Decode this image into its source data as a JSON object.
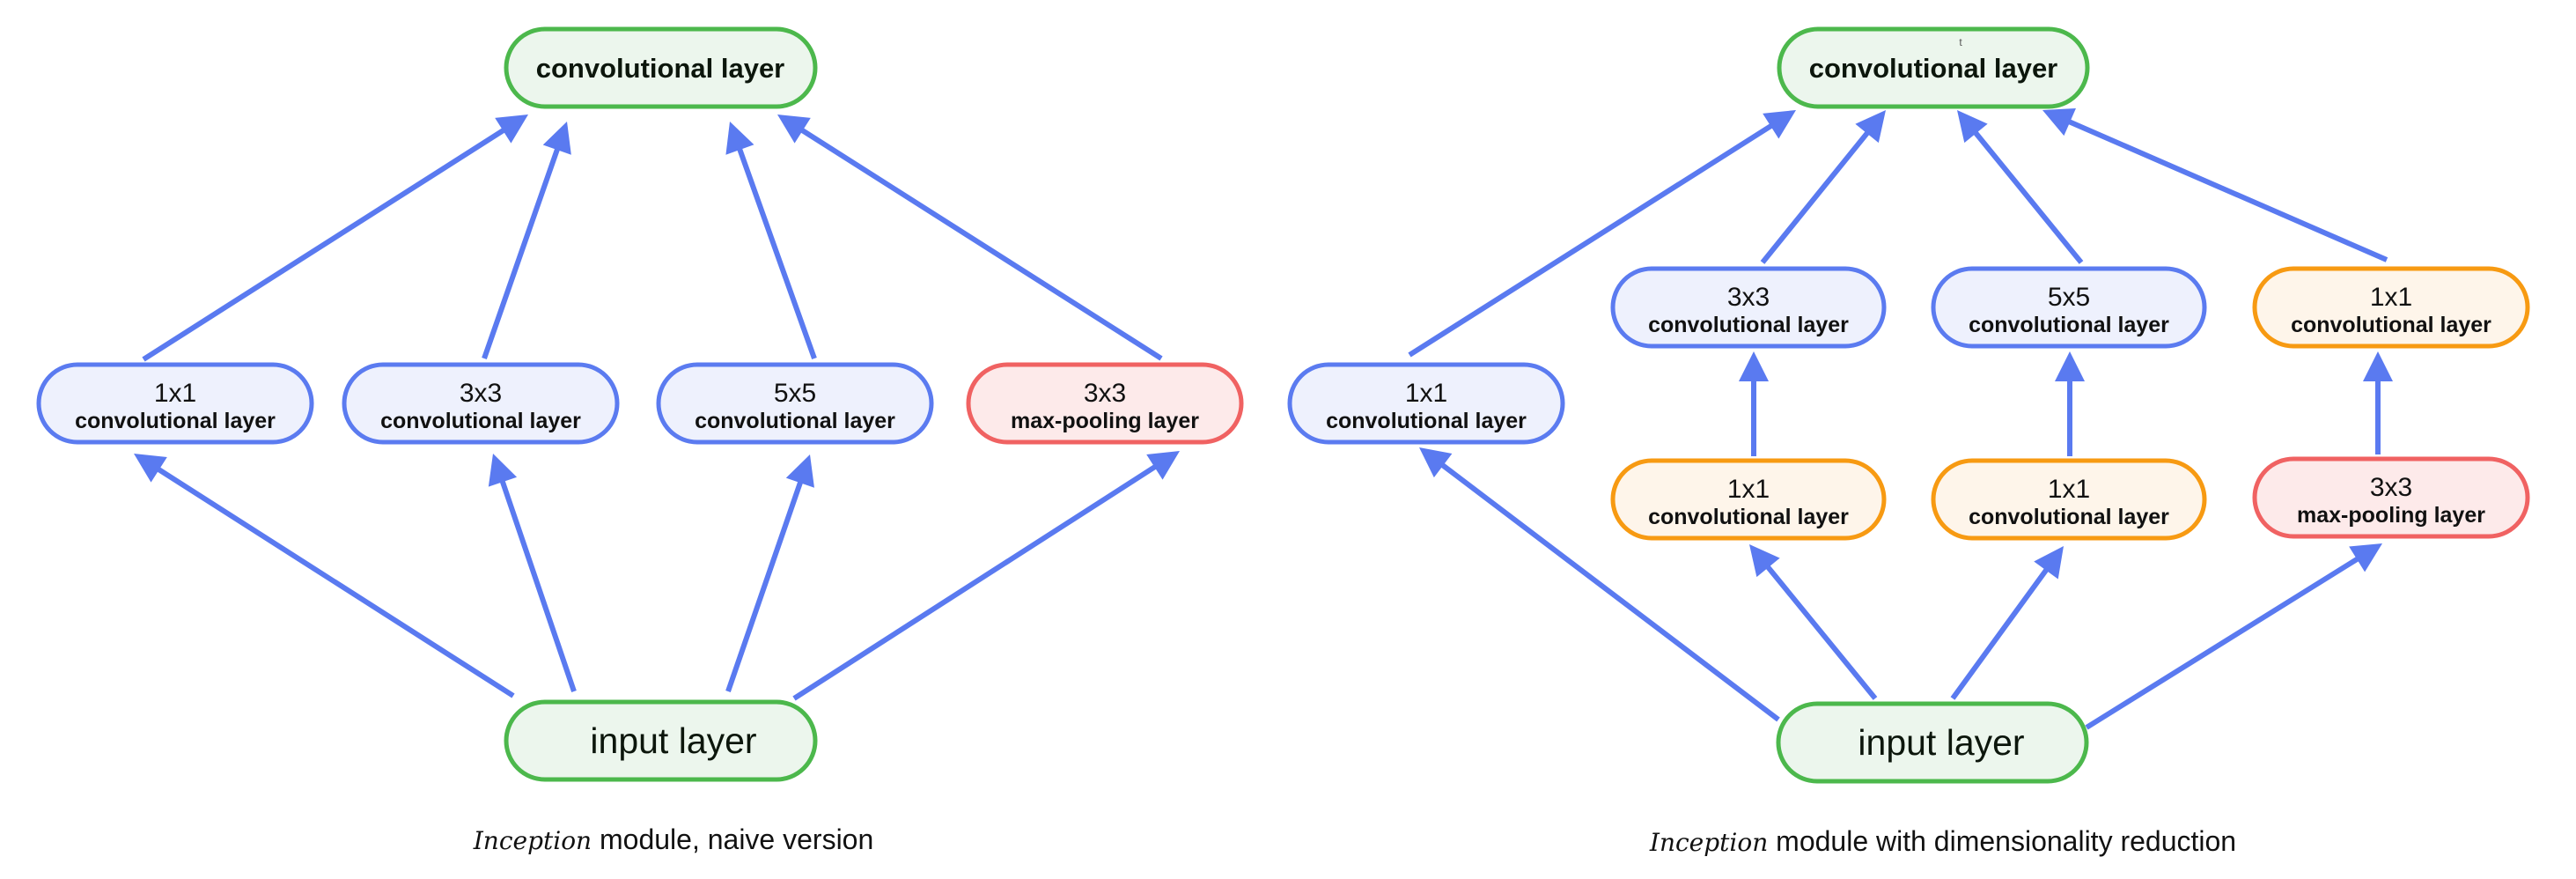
{
  "diagrams": [
    {
      "id": "naive",
      "caption": {
        "italic": "Inception",
        "rest": " module, naive version"
      },
      "nodes": {
        "top": {
          "label": "convolutional layer",
          "kind": "output",
          "color": "#4cb84c"
        },
        "c1": {
          "size": "1x1",
          "label": "convolutional layer",
          "kind": "conv",
          "color": "#5b7bf0"
        },
        "c3": {
          "size": "3x3",
          "label": "convolutional layer",
          "kind": "conv",
          "color": "#5b7bf0"
        },
        "c5": {
          "size": "5x5",
          "label": "convolutional layer",
          "kind": "conv",
          "color": "#5b7bf0"
        },
        "mp": {
          "size": "3x3",
          "label": "max-pooling layer",
          "kind": "pool",
          "color": "#f06262"
        },
        "input": {
          "label": "input layer",
          "kind": "input",
          "color": "#4cb84c"
        }
      },
      "edges": [
        {
          "from": "input",
          "to": "c1"
        },
        {
          "from": "input",
          "to": "c3"
        },
        {
          "from": "input",
          "to": "c5"
        },
        {
          "from": "input",
          "to": "mp"
        },
        {
          "from": "c1",
          "to": "top"
        },
        {
          "from": "c3",
          "to": "top"
        },
        {
          "from": "c5",
          "to": "top"
        },
        {
          "from": "mp",
          "to": "top"
        }
      ]
    },
    {
      "id": "reduced",
      "caption": {
        "italic": "Inception",
        "rest": " module with dimensionality reduction"
      },
      "stray_mark": "t",
      "nodes": {
        "top": {
          "label": "convolutional layer",
          "kind": "output",
          "color": "#4cb84c"
        },
        "c1": {
          "size": "1x1",
          "label": "convolutional layer",
          "kind": "conv",
          "color": "#5b7bf0"
        },
        "c3": {
          "size": "3x3",
          "label": "convolutional layer",
          "kind": "conv",
          "color": "#5b7bf0"
        },
        "c5": {
          "size": "5x5",
          "label": "convolutional layer",
          "kind": "conv",
          "color": "#5b7bf0"
        },
        "p1": {
          "size": "1x1",
          "label": "convolutional layer",
          "kind": "reduce",
          "color": "#f79a12"
        },
        "r3": {
          "size": "1x1",
          "label": "convolutional layer",
          "kind": "reduce",
          "color": "#f79a12"
        },
        "r5": {
          "size": "1x1",
          "label": "convolutional layer",
          "kind": "reduce",
          "color": "#f79a12"
        },
        "mp": {
          "size": "3x3",
          "label": "max-pooling layer",
          "kind": "pool",
          "color": "#f06262"
        },
        "input": {
          "label": "input layer",
          "kind": "input",
          "color": "#4cb84c"
        }
      },
      "edges": [
        {
          "from": "input",
          "to": "c1"
        },
        {
          "from": "input",
          "to": "r3"
        },
        {
          "from": "input",
          "to": "r5"
        },
        {
          "from": "input",
          "to": "mp"
        },
        {
          "from": "r3",
          "to": "c3"
        },
        {
          "from": "r5",
          "to": "c5"
        },
        {
          "from": "mp",
          "to": "p1"
        },
        {
          "from": "c1",
          "to": "top"
        },
        {
          "from": "c3",
          "to": "top"
        },
        {
          "from": "c5",
          "to": "top"
        },
        {
          "from": "p1",
          "to": "top"
        }
      ]
    }
  ],
  "colors": {
    "arrow": "#5a7af0",
    "output_input": "#4cb84c",
    "conv": "#5b7bf0",
    "reduce": "#f79a12",
    "pool": "#f06262"
  }
}
